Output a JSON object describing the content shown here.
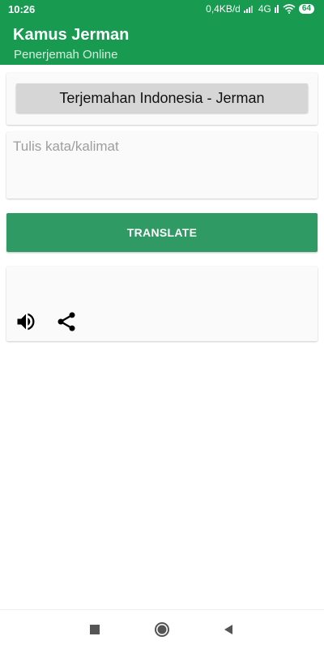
{
  "status_bar": {
    "time": "10:26",
    "network_speed": "0,4KB/d",
    "network_type": "4G",
    "battery": "64"
  },
  "app_bar": {
    "title": "Kamus Jerman",
    "subtitle": "Penerjemah Online"
  },
  "language_selector": {
    "label": "Terjemahan Indonesia - Jerman"
  },
  "input": {
    "value": "",
    "placeholder": "Tulis kata/kalimat"
  },
  "translate_button": {
    "label": "TRANSLATE"
  },
  "output": {
    "text": ""
  },
  "icons": {
    "speaker": "speaker-icon",
    "share": "share-icon",
    "recents": "square-icon",
    "home": "circle-icon",
    "back": "triangle-back-icon"
  },
  "colors": {
    "primary": "#189a50",
    "button": "#2f9a63",
    "card": "#fafafa"
  }
}
